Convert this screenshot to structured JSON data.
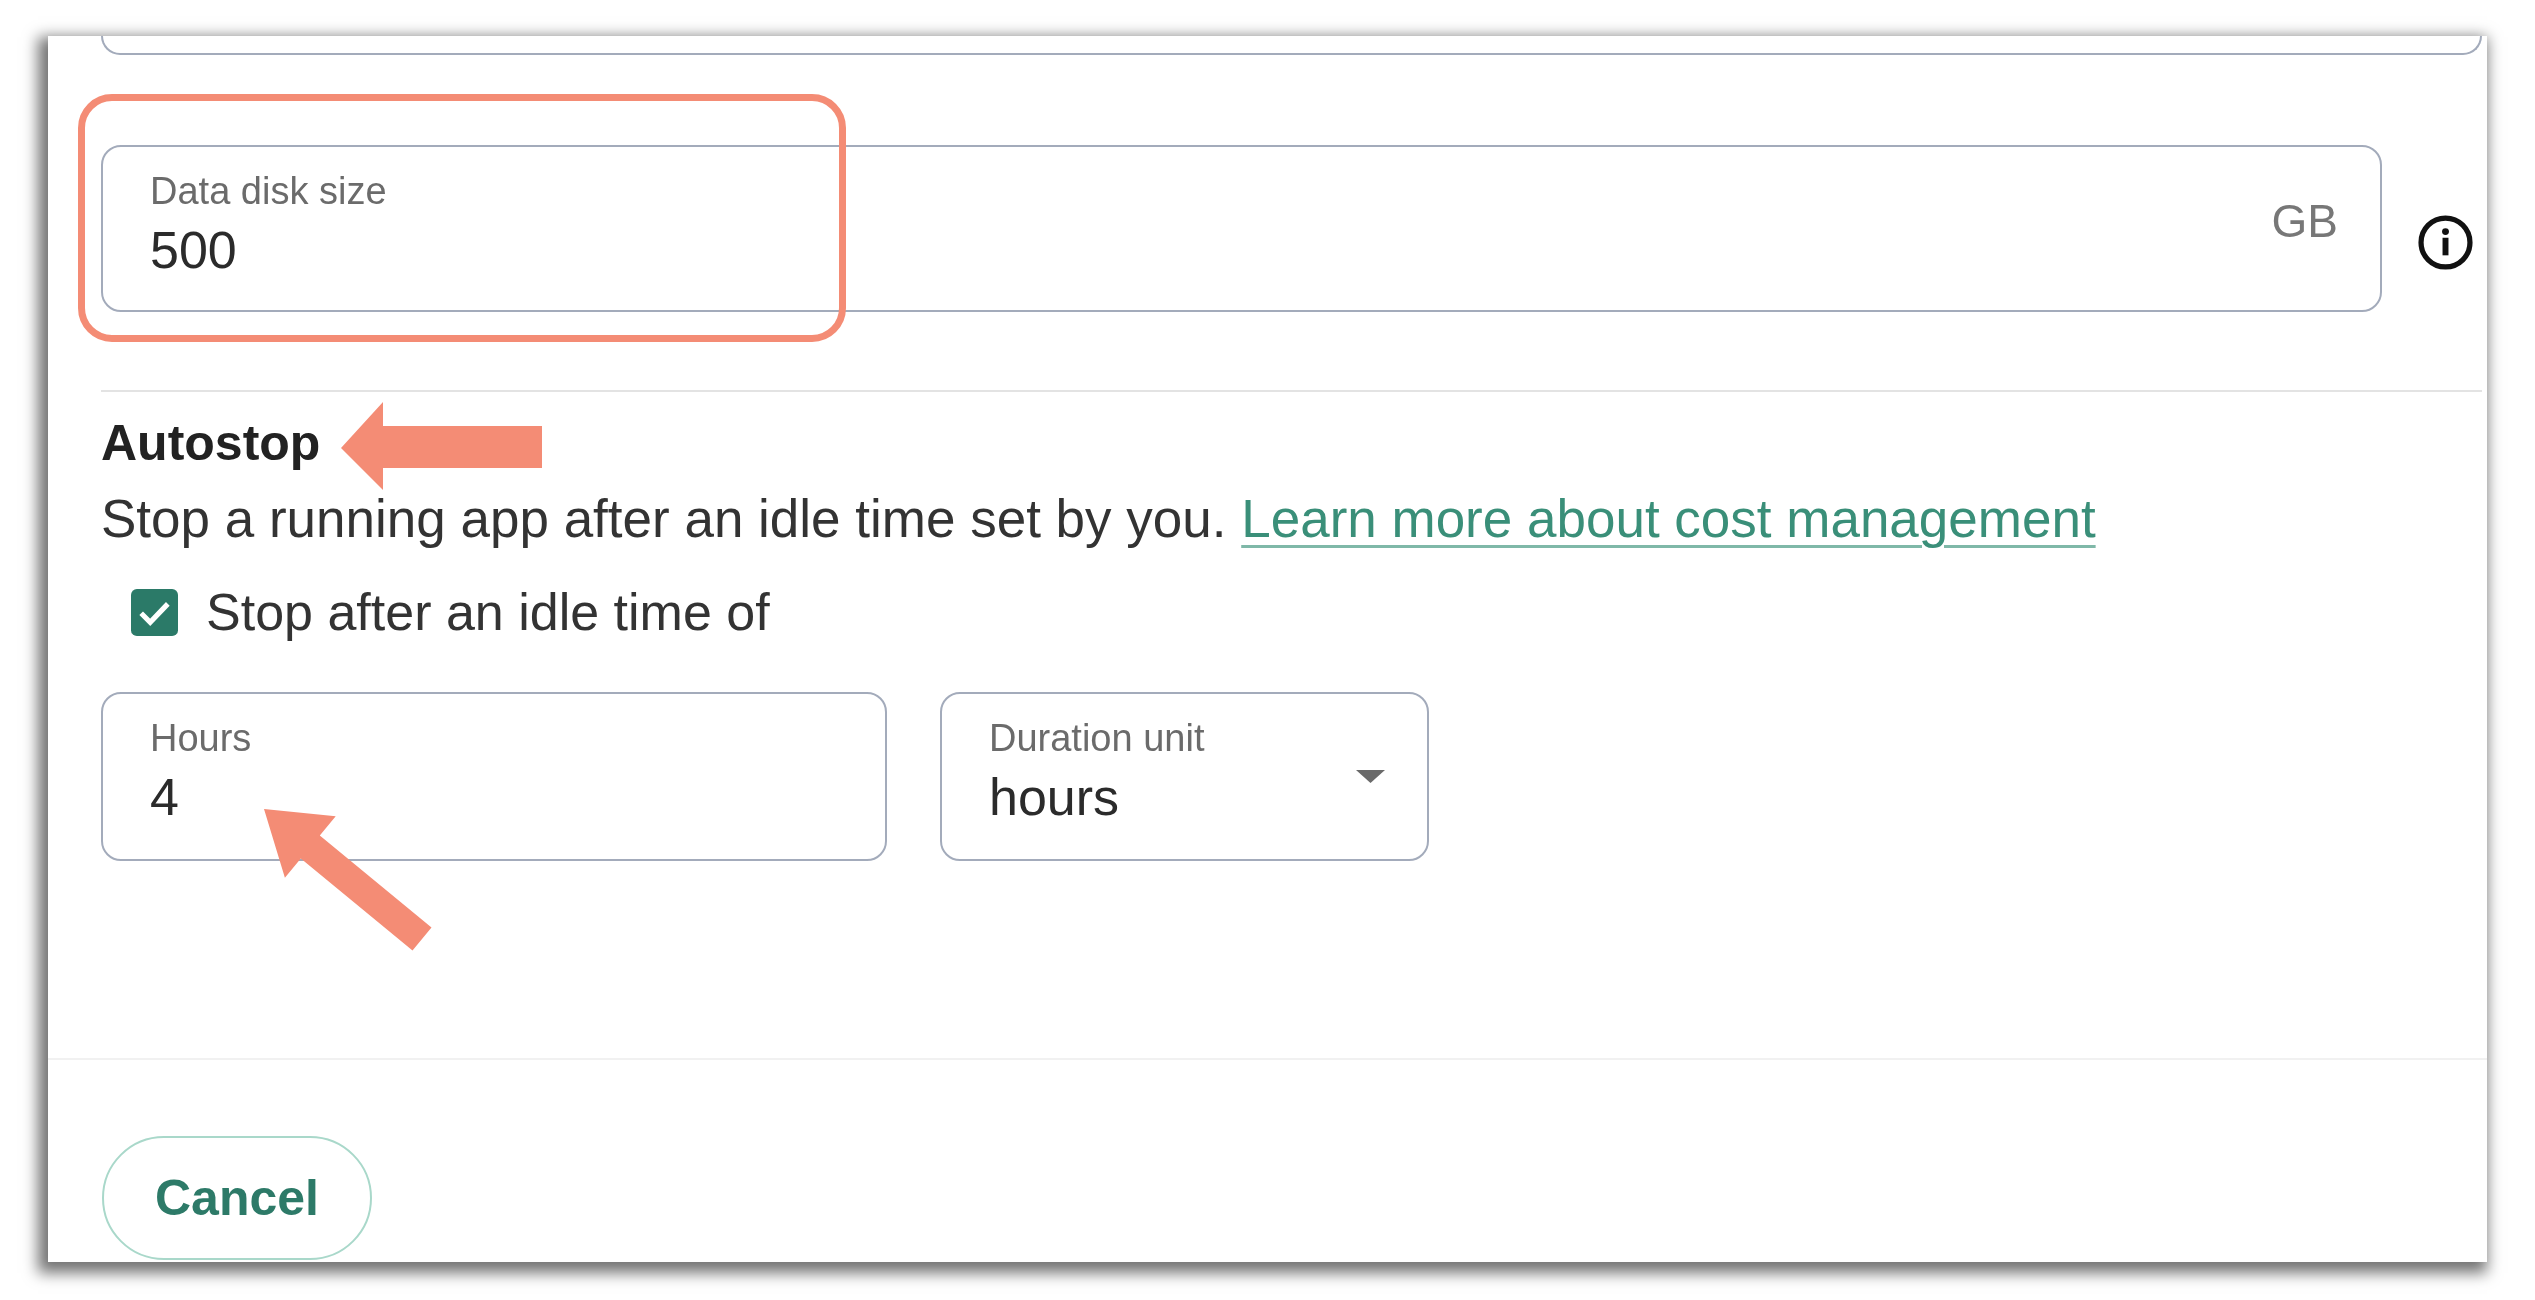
{
  "form": {
    "fields": [
      {
        "kind": "clipped"
      },
      {
        "kind": "text",
        "label": "Data disk size",
        "value": "500",
        "suffix": "GB",
        "info": true,
        "annotated": true
      }
    ]
  },
  "autostop": {
    "title": {
      "text": "Autostop",
      "annotated": true
    },
    "description": "Stop a running app after an idle time set by you.",
    "link": "Learn more about cost management",
    "checkbox": {
      "label": "Stop after an idle time of",
      "checked": true
    },
    "fields": [
      {
        "kind": "text",
        "label": "Hours",
        "value": "4",
        "annotated": true
      },
      {
        "kind": "select",
        "label": "Duration unit",
        "value": "hours"
      }
    ]
  },
  "footer": {
    "buttons": [
      {
        "label": "Cancel"
      }
    ]
  }
}
